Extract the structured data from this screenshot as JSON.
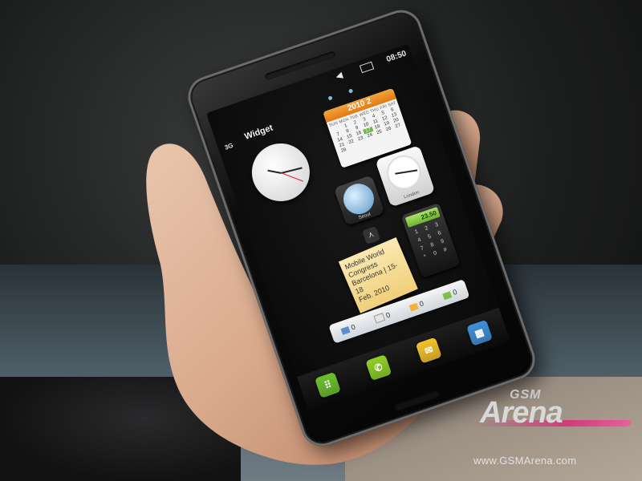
{
  "phone": {
    "status": {
      "signal": "3G",
      "time": "08:50"
    },
    "header": {
      "title": "Widget"
    },
    "calendar": {
      "year": "2010",
      "month": "2",
      "days_header": "SUN MON TUE WED THU FRI SAT",
      "dates": [
        "",
        "1",
        "2",
        "3",
        "4",
        "5",
        "6",
        "7",
        "8",
        "9",
        "10",
        "11",
        "12",
        "13",
        "14",
        "15",
        "16",
        "17",
        "18",
        "19",
        "20",
        "21",
        "22",
        "23",
        "24",
        "25",
        "26",
        "27",
        "28",
        "",
        "",
        "",
        "",
        "",
        ""
      ],
      "today": "17"
    },
    "world_clocks": {
      "seoul_label": "Seoul",
      "london_label": "London"
    },
    "calculator": {
      "display": "23.50",
      "keys": [
        "1",
        "2",
        "3",
        "4",
        "5",
        "6",
        "7",
        "8",
        "9",
        "*",
        "0",
        "#"
      ]
    },
    "note": {
      "lines": [
        "Mobile World",
        "Congress",
        "Barcelona | 15-18",
        "Feb. 2010"
      ]
    },
    "counters": {
      "contacts": "0",
      "messages": "0",
      "missed_calls": "0",
      "email": "0"
    },
    "dock": {
      "apps": [
        {
          "name": "keypad-icon",
          "color": "#6cbf2e"
        },
        {
          "name": "phone-icon",
          "color": "#8fcf27"
        },
        {
          "name": "message-icon",
          "color": "#f2c22a"
        },
        {
          "name": "menu-icon",
          "color": "#3f8fd8"
        }
      ]
    }
  },
  "watermark": {
    "brand_top": "GSM",
    "brand_main": "Arena",
    "url": "www.GSMArena.com"
  }
}
